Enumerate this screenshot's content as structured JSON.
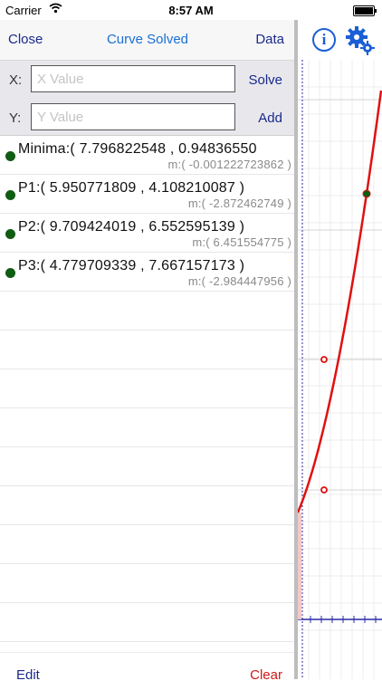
{
  "status_bar": {
    "carrier": "Carrier",
    "time": "8:57 AM"
  },
  "nav": {
    "close_label": "Close",
    "title": "Curve Solved",
    "data_label": "Data"
  },
  "inputs": {
    "x": {
      "label": "X:",
      "placeholder": "X Value",
      "value": "",
      "action_label": "Solve"
    },
    "y": {
      "label": "Y:",
      "placeholder": "Y Value",
      "value": "",
      "action_label": "Add"
    }
  },
  "points": [
    {
      "main": "Minima:( 7.796822548 , 0.94836550",
      "sub": "m:( -0.001222723862 )",
      "dot_color": "#0f5c12"
    },
    {
      "main": "P1:( 5.950771809 , 4.108210087 )",
      "sub": "m:( -2.872462749 )",
      "dot_color": "#0f5c12"
    },
    {
      "main": "P2:( 9.709424019 , 6.552595139 )",
      "sub": "m:( 6.451554775 )",
      "dot_color": "#0f5c12"
    },
    {
      "main": "P3:( 4.779709339 , 7.667157173 )",
      "sub": "m:( -2.984447956 )",
      "dot_color": "#0f5c12"
    }
  ],
  "toolbar": {
    "edit_label": "Edit",
    "clear_label": "Clear"
  },
  "graph": {
    "info_icon": "info-icon",
    "settings_icon": "gear-icon",
    "info_glyph": "i",
    "curve_color": "#e01010",
    "accent_color": "#1b5fd6"
  }
}
